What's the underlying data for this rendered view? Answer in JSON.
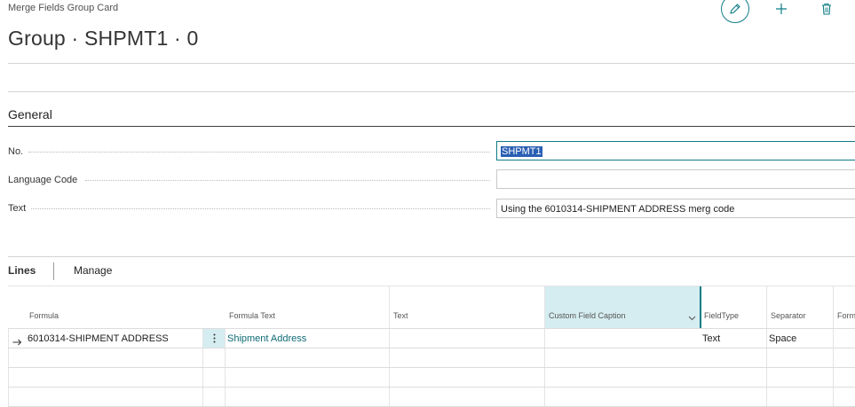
{
  "header": {
    "caption": "Merge Fields Group Card",
    "title": "Group · SHPMT1 · 0"
  },
  "general": {
    "section_title": "General",
    "fields": [
      {
        "label": "No.",
        "value": "SHPMT1"
      },
      {
        "label": "Language Code",
        "value": ""
      },
      {
        "label": "Text",
        "value": "Using the 6010314-SHIPMENT ADDRESS merg code"
      }
    ]
  },
  "lines": {
    "tabs": [
      "Lines",
      "Manage"
    ],
    "columns": [
      "Formula",
      "Formula Text",
      "Text",
      "Custom Field Caption",
      "FieldType",
      "Separator",
      "Form"
    ],
    "rows": [
      {
        "formula": "6010314-SHIPMENT ADDRESS",
        "formula_text": "Shipment Address",
        "text": "",
        "custom_field_caption": "",
        "field_type": "Text",
        "separator": "Space"
      }
    ]
  },
  "icons": {
    "edit": "pencil-icon",
    "add": "plus-icon",
    "delete": "trash-icon",
    "row_indicator": "arrow-right-icon",
    "row_menu": "vertical-ellipsis-icon",
    "column_dropdown": "chevron-down-icon"
  },
  "colors": {
    "accent": "#0e7c86",
    "link": "#0e6b74",
    "highlight": "#d5edf0",
    "selection": "#2a5fb3"
  }
}
